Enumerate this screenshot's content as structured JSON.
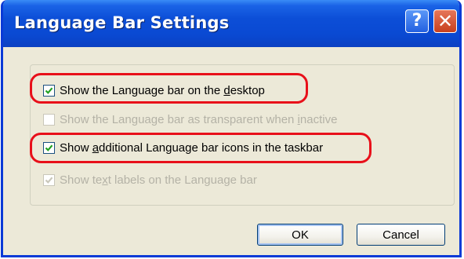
{
  "window": {
    "title": "Language Bar Settings",
    "help_glyph": "?",
    "close_glyph": "✕"
  },
  "options": [
    {
      "label_before": "Show the Language bar on the ",
      "label_mnemonic": "d",
      "label_after": "esktop",
      "checked": true,
      "enabled": true,
      "highlighted": true
    },
    {
      "label_before": "Show the Language bar as transparent when ",
      "label_mnemonic": "i",
      "label_after": "nactive",
      "checked": false,
      "enabled": false,
      "highlighted": false
    },
    {
      "label_before": "Show ",
      "label_mnemonic": "a",
      "label_after": "dditional Language bar icons in the taskbar",
      "checked": true,
      "enabled": true,
      "highlighted": true
    },
    {
      "label_before": "Show te",
      "label_mnemonic": "x",
      "label_after": "t labels on the Language bar",
      "checked": true,
      "enabled": false,
      "highlighted": false
    }
  ],
  "buttons": {
    "ok_label": "OK",
    "cancel_label": "Cancel"
  },
  "colors": {
    "highlight": "#e8101a",
    "titlebar": "#0a49d2",
    "check_enabled": "#21a121",
    "check_disabled": "#c9c7ba"
  }
}
